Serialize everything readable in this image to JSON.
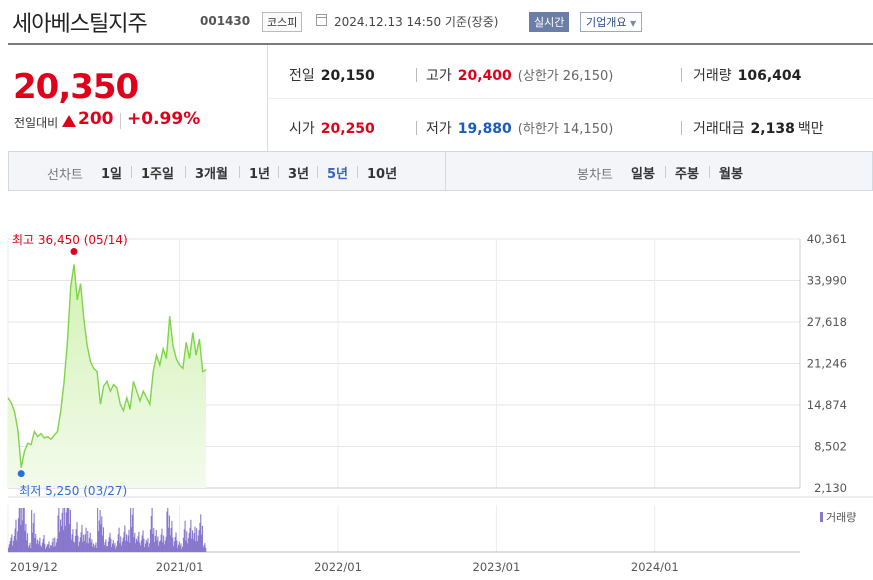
{
  "header": {
    "stock_name": "세아베스틸지주",
    "stock_code": "001430",
    "market": "코스피",
    "date": "2024.12.13 14:50 기준(장중)",
    "realtime": "실시간",
    "company": "기업개요",
    "company_icon": "triangle-down-icon"
  },
  "quote": {
    "price": "20,350",
    "change_label": "전일대비",
    "change_value": "200",
    "change_pct": "+0.99%",
    "prev_close_label": "전일",
    "prev_close": "20,150",
    "high_label": "고가",
    "high": "20,400",
    "upper_limit_label": "(상한가",
    "upper_limit": "26,150)",
    "volume_label": "거래량",
    "volume": "106,404",
    "open_label": "시가",
    "open": "20,250",
    "low_label": "저가",
    "low": "19,880",
    "lower_limit_label": "(하한가",
    "lower_limit": "14,150)",
    "amount_label": "거래대금",
    "amount": "2,138",
    "amount_unit": "백만",
    "colors": {
      "up": "#e0001a",
      "down": "#1a5bbd"
    }
  },
  "period": {
    "line_label": "선차트",
    "line_items": [
      "1일",
      "1주일",
      "3개월",
      "1년",
      "3년",
      "5년",
      "10년"
    ],
    "active": "5년",
    "candle_label": "봉차트",
    "candle_items": [
      "일봉",
      "주봉",
      "월봉"
    ]
  },
  "chart_data": {
    "type": "area",
    "y_ticks": [
      "40,361",
      "33,990",
      "27,618",
      "21,246",
      "14,874",
      "8,502",
      "2,130"
    ],
    "y_tick_values": [
      40361,
      33990,
      27618,
      21246,
      14874,
      8502,
      2130
    ],
    "ylim": [
      2130,
      40361
    ],
    "x_ticks": [
      "2019/12",
      "2021/01",
      "2022/01",
      "2023/01",
      "2024/01"
    ],
    "x_tick_positions": [
      0,
      13,
      25,
      37,
      49
    ],
    "x_range": [
      0,
      60
    ],
    "series": [
      {
        "values": [
          16000,
          15200,
          13800,
          11000,
          5250,
          7800,
          9000,
          8800,
          10800,
          10000,
          10500,
          9800,
          10000,
          9600,
          10200,
          10800,
          14000,
          18500,
          24500,
          33000,
          36450,
          31000,
          33500,
          28000,
          24000,
          21500,
          20500,
          20000,
          15000,
          17800,
          18500,
          17000,
          18000,
          17500,
          15000,
          14000,
          16000,
          14200,
          18500,
          17000,
          15500,
          17000,
          16000,
          15000,
          20000,
          22500,
          21000,
          23500,
          22000,
          28500,
          24000,
          22000,
          21000,
          20500,
          24500,
          22000,
          26000,
          22500,
          25000,
          20000,
          20300
        ],
        "x_step": 0.25
      }
    ],
    "high_label": "최고 36,450 (05/14)",
    "low_label": "최저 5,250 (03/27)",
    "volume_legend": "거래량",
    "colors": {
      "line": "#7fd448",
      "fill_top": "#d2f2b4",
      "fill_bottom": "#f3fbec",
      "high": "#e0001a",
      "low": "#2b6fd6",
      "volume": "#8877cc"
    },
    "grid": true
  }
}
